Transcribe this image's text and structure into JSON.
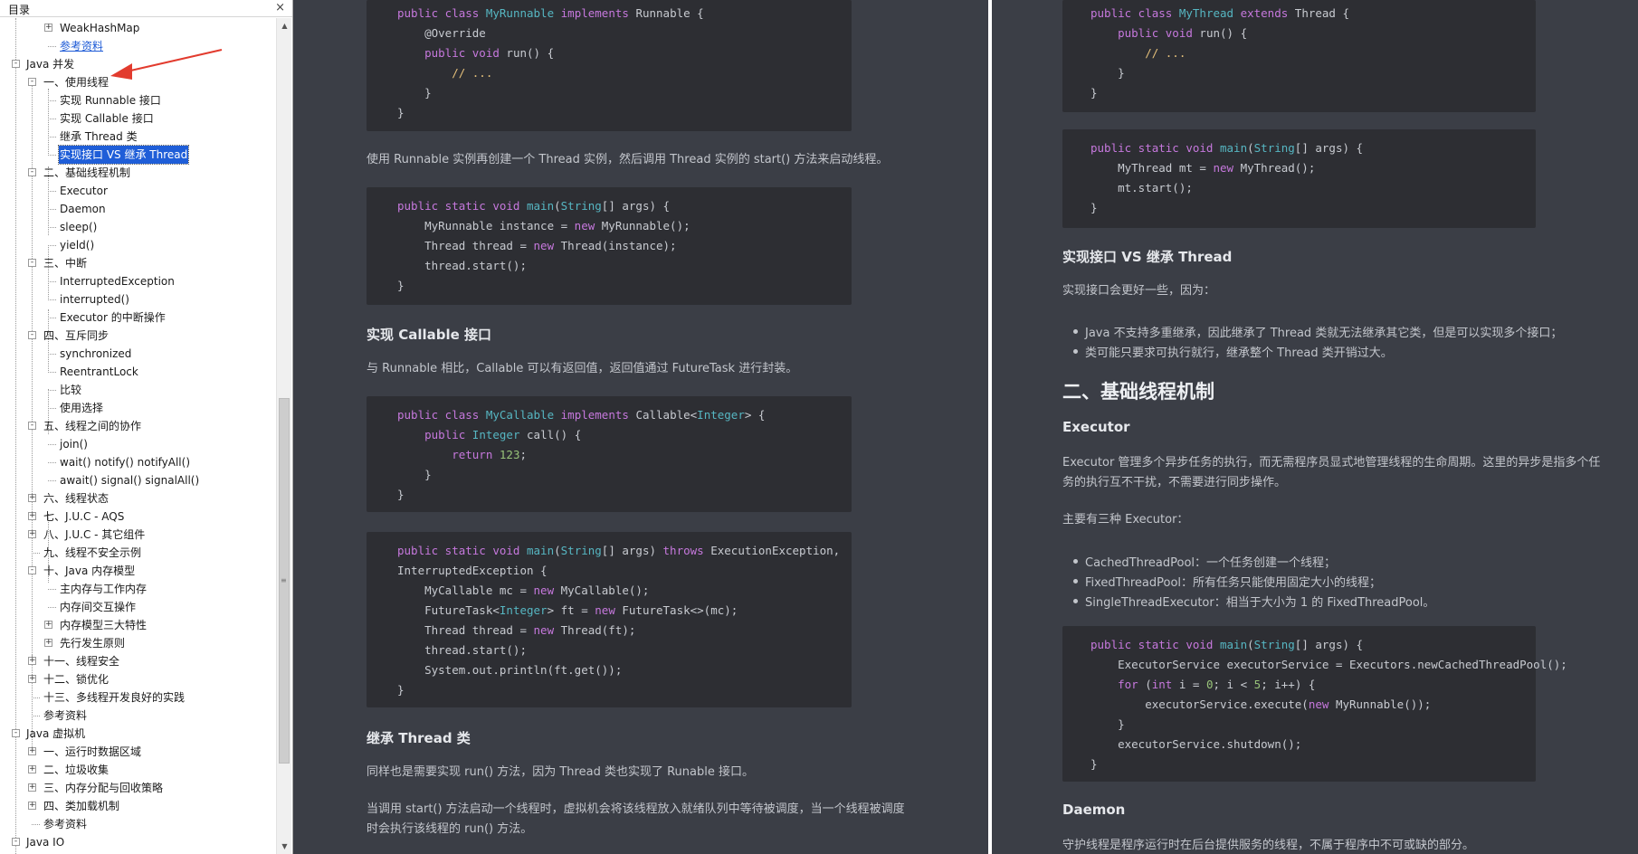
{
  "toc": {
    "title": "目录",
    "close": "×",
    "items": [
      {
        "label": "WeakHashMap",
        "exp": "+"
      },
      {
        "label": "参考资料",
        "link": true
      },
      {
        "label": "Java 并发",
        "exp": "-"
      },
      {
        "label": "一、使用线程",
        "exp": "-"
      },
      {
        "label": "实现 Runnable 接口"
      },
      {
        "label": "实现 Callable 接口"
      },
      {
        "label": "继承 Thread 类"
      },
      {
        "label": "实现接口 VS 继承 Thread",
        "selected": true
      },
      {
        "label": "二、基础线程机制",
        "exp": "-"
      },
      {
        "label": "Executor"
      },
      {
        "label": "Daemon"
      },
      {
        "label": "sleep()"
      },
      {
        "label": "yield()"
      },
      {
        "label": "三、中断",
        "exp": "-"
      },
      {
        "label": "InterruptedException"
      },
      {
        "label": "interrupted()"
      },
      {
        "label": "Executor 的中断操作"
      },
      {
        "label": "四、互斥同步",
        "exp": "-"
      },
      {
        "label": "synchronized"
      },
      {
        "label": "ReentrantLock"
      },
      {
        "label": "比较"
      },
      {
        "label": "使用选择"
      },
      {
        "label": "五、线程之间的协作",
        "exp": "-"
      },
      {
        "label": "join()"
      },
      {
        "label": "wait() notify() notifyAll()"
      },
      {
        "label": "await() signal() signalAll()"
      },
      {
        "label": "六、线程状态",
        "exp": "+"
      },
      {
        "label": "七、J.U.C - AQS",
        "exp": "+"
      },
      {
        "label": "八、J.U.C - 其它组件",
        "exp": "+"
      },
      {
        "label": "九、线程不安全示例"
      },
      {
        "label": "十、Java 内存模型",
        "exp": "-"
      },
      {
        "label": "主内存与工作内存"
      },
      {
        "label": "内存间交互操作"
      },
      {
        "label": "内存模型三大特性",
        "exp": "+"
      },
      {
        "label": "先行发生原则",
        "exp": "+"
      },
      {
        "label": "十一、线程安全",
        "exp": "+"
      },
      {
        "label": "十二、锁优化",
        "exp": "+"
      },
      {
        "label": "十三、多线程开发良好的实践"
      },
      {
        "label": "参考资料"
      },
      {
        "label": "Java 虚拟机",
        "exp": "-"
      },
      {
        "label": "一、运行时数据区域",
        "exp": "+"
      },
      {
        "label": "二、垃圾收集",
        "exp": "+"
      },
      {
        "label": "三、内存分配与回收策略",
        "exp": "+"
      },
      {
        "label": "四、类加载机制",
        "exp": "+"
      },
      {
        "label": "参考资料"
      },
      {
        "label": "Java IO",
        "exp": "-"
      }
    ]
  },
  "left": {
    "code1": [
      "public class MyRunnable implements Runnable {",
      "    @Override",
      "    public void run() {",
      "        // ...",
      "    }",
      "}"
    ],
    "p1": "使用 Runnable 实例再创建一个 Thread 实例，然后调用 Thread 实例的 start() 方法来启动线程。",
    "code2": [
      "public static void main(String[] args) {",
      "    MyRunnable instance = new MyRunnable();",
      "    Thread thread = new Thread(instance);",
      "    thread.start();",
      "}"
    ],
    "h_callable": "实现 Callable 接口",
    "p2": "与 Runnable 相比，Callable 可以有返回值，返回值通过 FutureTask 进行封装。",
    "code3": [
      "public class MyCallable implements Callable<Integer> {",
      "    public Integer call() {",
      "        return 123;",
      "    }",
      "}"
    ],
    "code4": [
      "public static void main(String[] args) throws ExecutionException,",
      "InterruptedException {",
      "    MyCallable mc = new MyCallable();",
      "    FutureTask<Integer> ft = new FutureTask<>(mc);",
      "    Thread thread = new Thread(ft);",
      "    thread.start();",
      "    System.out.println(ft.get());",
      "}"
    ],
    "h_thread": "继承 Thread 类",
    "p3": "同样也是需要实现 run() 方法，因为 Thread 类也实现了 Runable 接口。",
    "p4a": "当调用 start() 方法启动一个线程时，虚拟机会将该线程放入就绪队列中等待被调度，当一个线程被调度",
    "p4b": "时会执行该线程的 run() 方法。"
  },
  "right": {
    "code1": [
      "public class MyThread extends Thread {",
      "    public void run() {",
      "        // ...",
      "    }",
      "}"
    ],
    "code2": [
      "public static void main(String[] args) {",
      "    MyThread mt = new MyThread();",
      "    mt.start();",
      "}"
    ],
    "h_vs": "实现接口 VS 继承 Thread",
    "p1": "实现接口会更好一些，因为：",
    "li1": "Java 不支持多重继承，因此继承了 Thread 类就无法继承其它类，但是可以实现多个接口；",
    "li2": "类可能只要求可执行就行，继承整个 Thread 类开销过大。",
    "h2_basic": "二、基础线程机制",
    "h_executor": "Executor",
    "p2a": "Executor 管理多个异步任务的执行，而无需程序员显式地管理线程的生命周期。这里的异步是指多个任",
    "p2b": "务的执行互不干扰，不需要进行同步操作。",
    "p3": "主要有三种 Executor：",
    "li3": "CachedThreadPool：一个任务创建一个线程；",
    "li4": "FixedThreadPool：所有任务只能使用固定大小的线程；",
    "li5": "SingleThreadExecutor：相当于大小为 1 的 FixedThreadPool。",
    "code3": [
      "public static void main(String[] args) {",
      "    ExecutorService executorService = Executors.newCachedThreadPool();",
      "    for (int i = 0; i < 5; i++) {",
      "        executorService.execute(new MyRunnable());",
      "    }",
      "    executorService.shutdown();",
      "}"
    ],
    "h_daemon": "Daemon",
    "p4": "守护线程是程序运行时在后台提供服务的线程，不属于程序中不可或缺的部分。"
  },
  "colors": {
    "accent_arrow": "#e23b2e",
    "selected": "#1f5ed8",
    "link": "#1e5bd6",
    "code_bg": "#2d2e33",
    "pane_bg": "#3b3e46"
  }
}
